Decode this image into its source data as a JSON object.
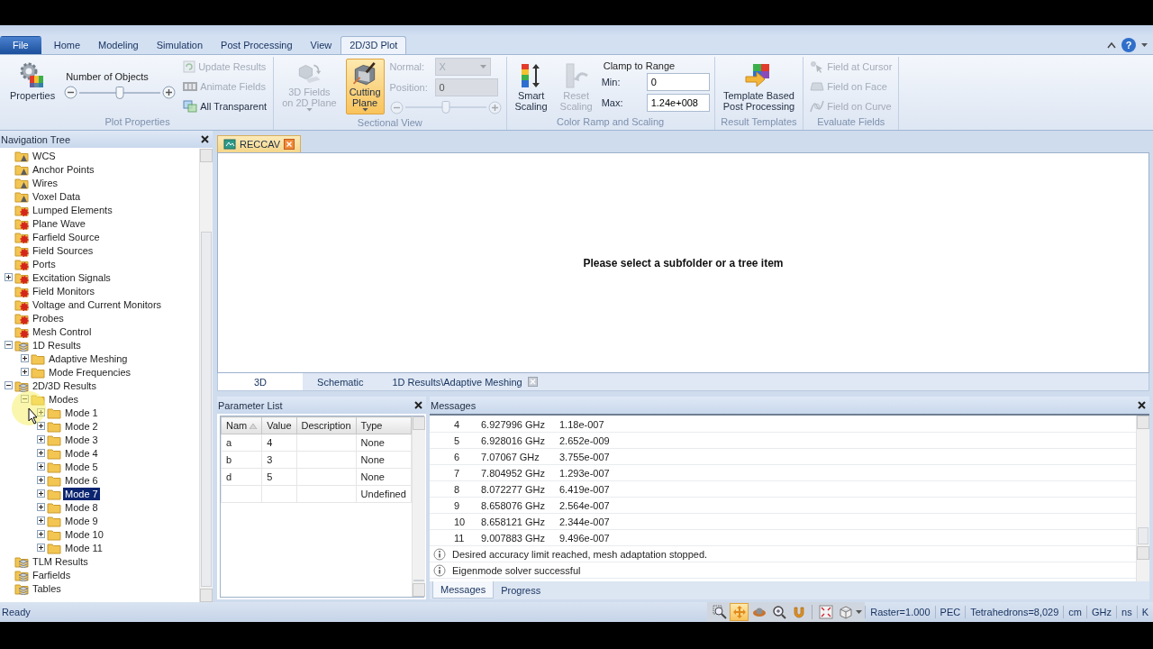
{
  "ribbon": {
    "tabs": [
      {
        "label": "File",
        "kind": "menu",
        "selected": false
      },
      {
        "label": "Home",
        "kind": "tab",
        "selected": false
      },
      {
        "label": "Modeling",
        "kind": "tab",
        "selected": false
      },
      {
        "label": "Simulation",
        "kind": "tab",
        "selected": false
      },
      {
        "label": "Post Processing",
        "kind": "tab",
        "selected": false
      },
      {
        "label": "View",
        "kind": "tab",
        "selected": false
      },
      {
        "label": "2D/3D Plot",
        "kind": "tab",
        "selected": true
      }
    ],
    "help": "?",
    "groups": [
      {
        "label": "Plot Properties",
        "columns": [
          [
            {
              "kind": "large",
              "label": "Properties",
              "disabled": false,
              "active": false,
              "dropdown": false
            }
          ],
          [
            {
              "kind": "caption",
              "label": "Number of Objects"
            },
            {
              "kind": "slider",
              "level": 0.5,
              "disabled": false
            }
          ],
          [
            {
              "kind": "small",
              "label": "Update Results",
              "disabled": true
            },
            {
              "kind": "small",
              "label": "Animate Fields",
              "disabled": true
            },
            {
              "kind": "small",
              "label": "All Transparent",
              "disabled": false
            }
          ]
        ]
      },
      {
        "label": "Sectional View",
        "columns": [
          [
            {
              "kind": "large",
              "label": "3D Fields\non 2D Plane",
              "disabled": true,
              "active": false,
              "dropdown": true
            }
          ],
          [
            {
              "kind": "large",
              "label": "Cutting\nPlane",
              "disabled": false,
              "active": true,
              "dropdown": true
            }
          ],
          [
            {
              "kind": "combo",
              "label": "Normal:",
              "value": "X",
              "disabled": true
            },
            {
              "kind": "field",
              "label": "Position:",
              "value": "0",
              "disabled": true
            },
            {
              "kind": "slider",
              "level": 0.5,
              "disabled": true
            }
          ]
        ]
      },
      {
        "label": "Color Ramp and Scaling",
        "columns": [
          [
            {
              "kind": "large",
              "label": "Smart\nScaling",
              "disabled": false,
              "active": false,
              "dropdown": false
            }
          ],
          [
            {
              "kind": "large",
              "label": "Reset\nScaling",
              "disabled": true,
              "active": false,
              "dropdown": false
            }
          ],
          [
            {
              "kind": "caption",
              "label": "Clamp to Range"
            },
            {
              "kind": "field",
              "label": "Min:",
              "value": "0",
              "disabled": false
            },
            {
              "kind": "field",
              "label": "Max:",
              "value": "1.24e+008",
              "disabled": false
            }
          ]
        ]
      },
      {
        "label": "Result Templates",
        "columns": [
          [
            {
              "kind": "large",
              "label": "Template Based\nPost Processing",
              "disabled": false,
              "active": false,
              "dropdown": false
            }
          ]
        ]
      },
      {
        "label": "Evaluate Fields",
        "columns": [
          [
            {
              "kind": "small",
              "label": "Field at Cursor",
              "disabled": true
            },
            {
              "kind": "small",
              "label": "Field on Face",
              "disabled": true
            },
            {
              "kind": "small",
              "label": "Field on Curve",
              "disabled": true
            }
          ]
        ]
      }
    ]
  },
  "navigation_tree": {
    "title": "Navigation Tree",
    "items": [
      {
        "label": "WCS",
        "kind": "triangle",
        "selected": false
      },
      {
        "label": "Anchor Points",
        "kind": "triangle",
        "selected": false
      },
      {
        "label": "Wires",
        "kind": "triangle",
        "selected": false
      },
      {
        "label": "Voxel Data",
        "kind": "triangle",
        "selected": false
      },
      {
        "label": "Lumped Elements",
        "kind": "gear",
        "selected": false
      },
      {
        "label": "Plane Wave",
        "kind": "gear",
        "selected": false
      },
      {
        "label": "Farfield Source",
        "kind": "gear",
        "selected": false
      },
      {
        "label": "Field Sources",
        "kind": "gear",
        "selected": false
      },
      {
        "label": "Ports",
        "kind": "gear",
        "selected": false
      },
      {
        "label": "Excitation Signals",
        "kind": "gear",
        "selected": false,
        "expanded": false
      },
      {
        "label": "Field Monitors",
        "kind": "gear",
        "selected": false
      },
      {
        "label": "Voltage and Current Monitors",
        "kind": "gear",
        "selected": false
      },
      {
        "label": "Probes",
        "kind": "gear",
        "selected": false
      },
      {
        "label": "Mesh Control",
        "kind": "gear",
        "selected": false
      },
      {
        "label": "1D Results",
        "kind": "stack",
        "selected": false,
        "expanded": true,
        "children": [
          {
            "label": "Adaptive Meshing",
            "kind": "folder",
            "selected": false,
            "expanded": false
          },
          {
            "label": "Mode Frequencies",
            "kind": "folder",
            "selected": false,
            "expanded": false
          }
        ]
      },
      {
        "label": "2D/3D Results",
        "kind": "stack",
        "selected": false,
        "expanded": true,
        "children": [
          {
            "label": "Modes",
            "kind": "folder",
            "selected": false,
            "expanded": true,
            "children": [
              {
                "label": "Mode 1",
                "kind": "folder",
                "selected": false,
                "expanded": false
              },
              {
                "label": "Mode 2",
                "kind": "folder",
                "selected": false,
                "expanded": false
              },
              {
                "label": "Mode 3",
                "kind": "folder",
                "selected": false,
                "expanded": false
              },
              {
                "label": "Mode 4",
                "kind": "folder",
                "selected": false,
                "expanded": false
              },
              {
                "label": "Mode 5",
                "kind": "folder",
                "selected": false,
                "expanded": false
              },
              {
                "label": "Mode 6",
                "kind": "folder",
                "selected": false,
                "expanded": false
              },
              {
                "label": "Mode 7",
                "kind": "folder",
                "selected": true,
                "expanded": false
              },
              {
                "label": "Mode 8",
                "kind": "folder",
                "selected": false,
                "expanded": false
              },
              {
                "label": "Mode 9",
                "kind": "folder",
                "selected": false,
                "expanded": false
              },
              {
                "label": "Mode 10",
                "kind": "folder",
                "selected": false,
                "expanded": false
              },
              {
                "label": "Mode 11",
                "kind": "folder",
                "selected": false,
                "expanded": false
              }
            ]
          }
        ]
      },
      {
        "label": "TLM Results",
        "kind": "stack",
        "selected": false
      },
      {
        "label": "Farfields",
        "kind": "stack",
        "selected": false
      },
      {
        "label": "Tables",
        "kind": "stack",
        "selected": false
      }
    ]
  },
  "document": {
    "tabs": [
      {
        "label": "RECCAV",
        "selected": true
      }
    ],
    "message": "Please select a subfolder or a tree item",
    "view_tabs": [
      {
        "label": "3D",
        "selected": true,
        "closable": false
      },
      {
        "label": "Schematic",
        "selected": false,
        "closable": false
      },
      {
        "label": "1D Results\\Adaptive Meshing",
        "selected": false,
        "closable": true
      }
    ]
  },
  "parameter_list": {
    "title": "Parameter List",
    "columns": [
      {
        "label": "Nam",
        "sorted": true
      },
      {
        "label": "Value",
        "sorted": false
      },
      {
        "label": "Description",
        "sorted": false
      },
      {
        "label": "Type",
        "sorted": false
      }
    ],
    "rows": [
      {
        "name": "a",
        "value": "4",
        "type": "None"
      },
      {
        "name": "b",
        "value": "3",
        "type": "None"
      },
      {
        "name": "d",
        "value": "5",
        "type": "None"
      },
      {
        "type": "Undefined"
      }
    ]
  },
  "messages": {
    "title": "Messages",
    "rows": [
      {
        "kind": "result",
        "index": "4",
        "frequency": "6.927996 GHz",
        "accuracy": "1.18e-007"
      },
      {
        "kind": "result",
        "index": "5",
        "frequency": "6.928016 GHz",
        "accuracy": "2.652e-009"
      },
      {
        "kind": "result",
        "index": "6",
        "frequency": "7.07067 GHz",
        "accuracy": "3.755e-007"
      },
      {
        "kind": "result",
        "index": "7",
        "frequency": "7.804952 GHz",
        "accuracy": "1.293e-007"
      },
      {
        "kind": "result",
        "index": "8",
        "frequency": "8.072277 GHz",
        "accuracy": "6.419e-007"
      },
      {
        "kind": "result",
        "index": "9",
        "frequency": "8.658076 GHz",
        "accuracy": "2.564e-007"
      },
      {
        "kind": "result",
        "index": "10",
        "frequency": "8.658121 GHz",
        "accuracy": "2.344e-007"
      },
      {
        "kind": "result",
        "index": "11",
        "frequency": "9.007883 GHz",
        "accuracy": "9.496e-007"
      },
      {
        "kind": "info",
        "text": "Desired accuracy limit reached, mesh adaptation stopped."
      },
      {
        "kind": "info",
        "text": "Eigenmode solver successful"
      }
    ],
    "tabs": [
      {
        "label": "Messages",
        "selected": true
      },
      {
        "label": "Progress",
        "selected": false
      }
    ]
  },
  "status_bar": {
    "text": "Ready",
    "tools": [
      {
        "selected": false
      },
      {
        "selected": true
      },
      {
        "selected": false
      },
      {
        "selected": false
      },
      {
        "selected": false
      },
      {
        "selected": false
      },
      {
        "selected": false
      }
    ],
    "items": [
      "Raster=1.000",
      "PEC",
      "Tetrahedrons=8,029",
      "cm",
      "GHz",
      "ns",
      "K"
    ]
  }
}
